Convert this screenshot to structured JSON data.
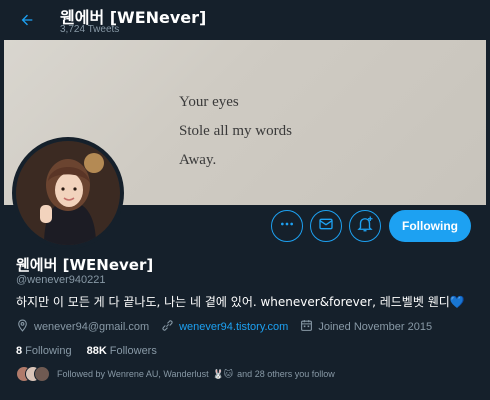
{
  "header": {
    "title": "웬에버 [WENever]",
    "tweet_count": "3,724 Tweets"
  },
  "banner": {
    "lines": [
      "Your eyes",
      "Stole all my words",
      "Away."
    ]
  },
  "actions": {
    "following_label": "Following",
    "accent_color": "#1da1f2"
  },
  "profile": {
    "name": "웬에버 [WENever]",
    "handle": "@wenever940221",
    "bio": "하지만 이 모든 게 다 끝나도, 나는 네 곁에 있어. whenever&forever, 레드벨벳 웬디",
    "bio_emoji": "💙",
    "email": "wenever94@gmail.com",
    "website": "wenever94.tistory.com",
    "joined": "Joined November 2015"
  },
  "stats": {
    "following_count": "8",
    "following_label": "Following",
    "followers_count": "88K",
    "followers_label": "Followers"
  },
  "followed_by": {
    "text_before": "Followed by Wenrene AU, Wanderlust",
    "emoji": "🐰🐱",
    "text_after": "and 28 others you follow"
  },
  "icons": [
    "back-arrow-icon",
    "more-icon",
    "mail-icon",
    "notification-add-icon",
    "location-icon",
    "link-icon",
    "calendar-icon"
  ]
}
